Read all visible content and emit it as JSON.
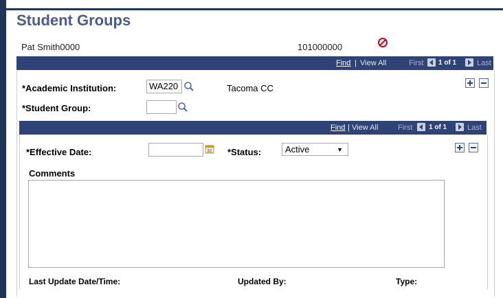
{
  "page": {
    "title": "Student Groups"
  },
  "student": {
    "name": "Pat Smith0000",
    "id": "101000000"
  },
  "institution_bar": {
    "find": "Find",
    "sep": "|",
    "view_all": "View All",
    "first": "First",
    "count": "1 of 1",
    "last": "Last"
  },
  "institution": {
    "label": "*Academic Institution:",
    "value": "WA220",
    "description": "Tacoma CC"
  },
  "group": {
    "label": "*Student Group:",
    "value": ""
  },
  "effdt_bar": {
    "find": "Find",
    "sep": "|",
    "view_all": "View All",
    "first": "First",
    "count": "1 of 1",
    "last": "Last"
  },
  "effective": {
    "label": "*Effective Date:",
    "value": "",
    "status_label": "*Status:",
    "status_value": "Active"
  },
  "comments": {
    "label": "Comments",
    "value": ""
  },
  "footer": {
    "last_update": "Last Update Date/Time:",
    "updated_by": "Updated By:",
    "type": "Type:"
  },
  "icons": [
    "block-icon",
    "search-icon",
    "calendar-icon",
    "add-row-icon",
    "delete-row-icon",
    "first-arrow-icon",
    "last-arrow-icon"
  ],
  "colors": {
    "bar": "#2f4377",
    "title": "#4a5b8c",
    "frame": "#1f3457",
    "block": "#d0021b"
  }
}
